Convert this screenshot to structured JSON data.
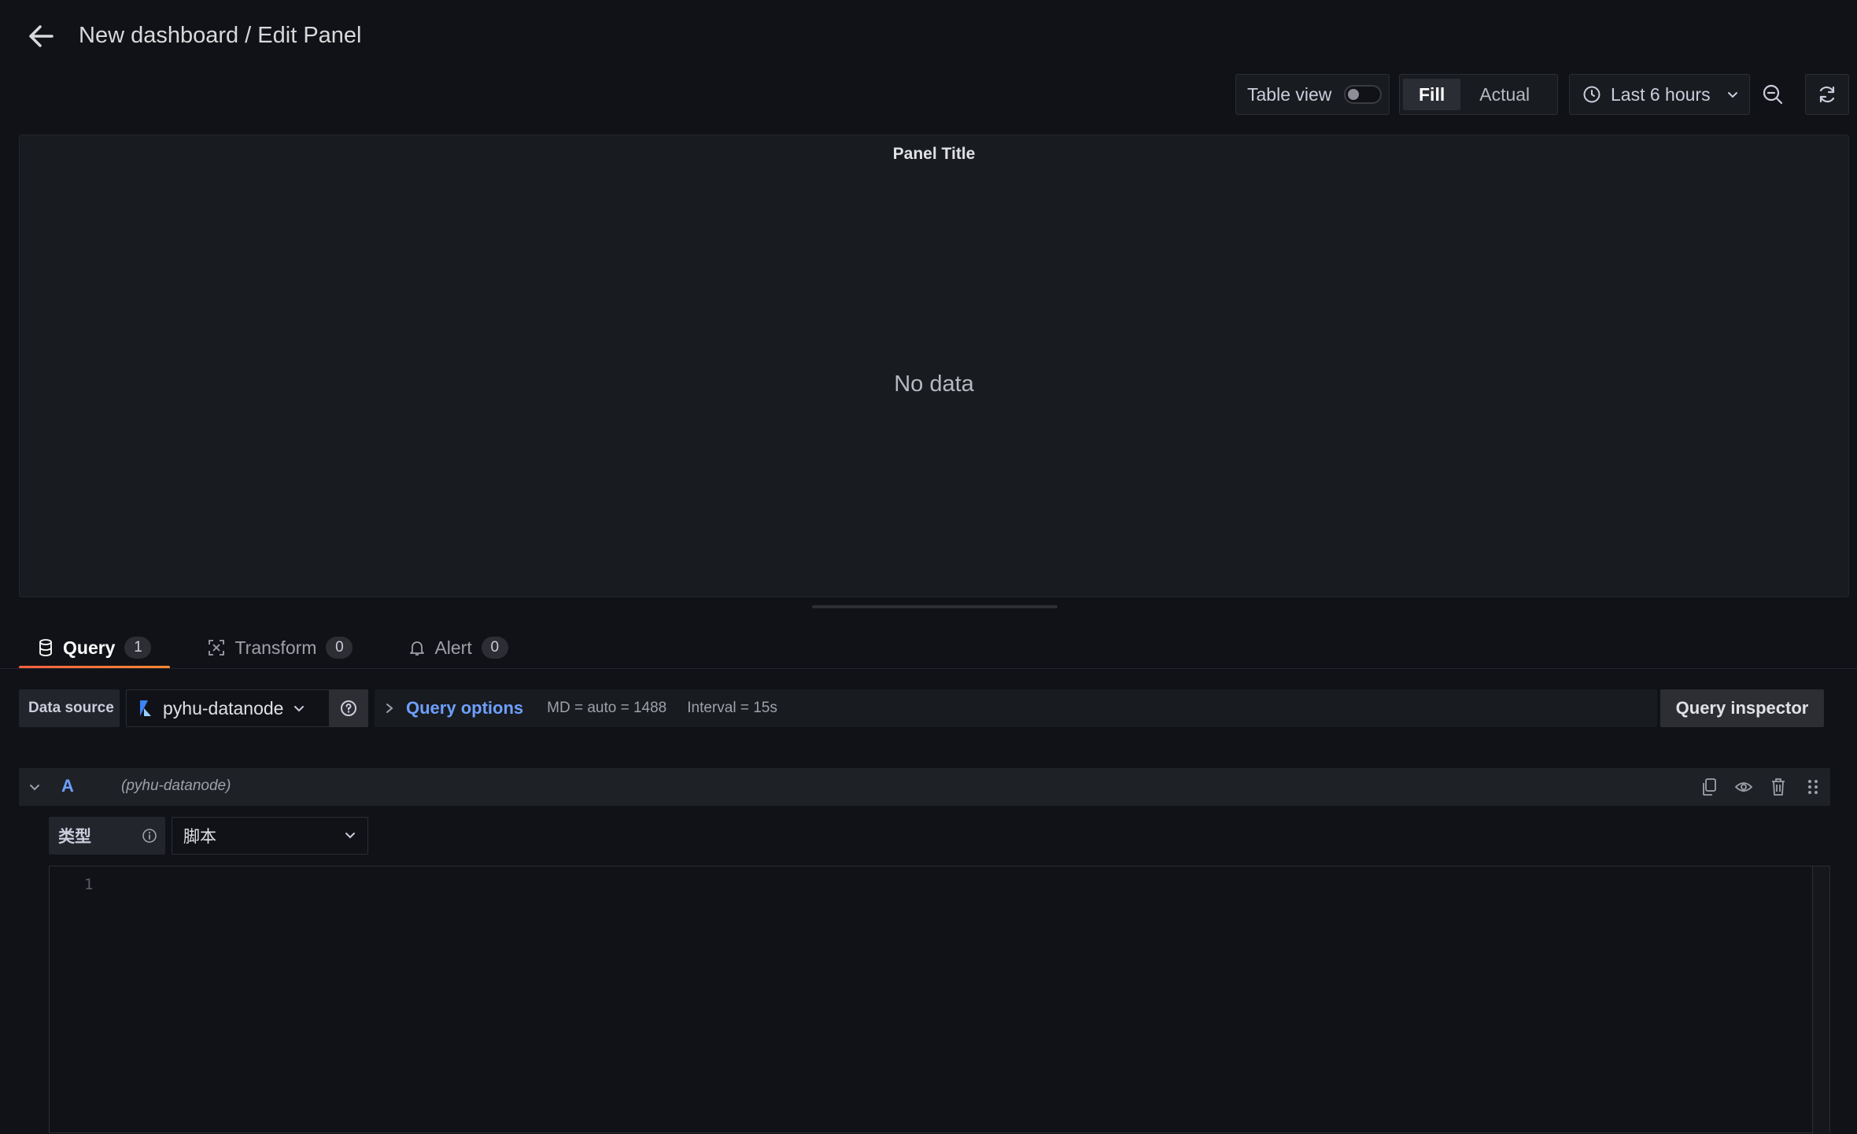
{
  "header": {
    "title": "New dashboard / Edit Panel",
    "back_icon": "arrow-left-icon"
  },
  "toolbar": {
    "table_view_label": "Table view",
    "table_view_on": false,
    "fill_label": "Fill",
    "actual_label": "Actual",
    "time_range_label": "Last 6 hours"
  },
  "panel": {
    "title": "Panel Title",
    "empty_text": "No data"
  },
  "tabs": [
    {
      "label": "Query",
      "count": "1",
      "icon": "database-icon"
    },
    {
      "label": "Transform",
      "count": "0",
      "icon": "transform-icon"
    },
    {
      "label": "Alert",
      "count": "0",
      "icon": "bell-icon"
    }
  ],
  "datasource": {
    "label": "Data source",
    "selected": "pyhu-datanode",
    "query_options_label": "Query options",
    "md_text": "MD = auto = 1488",
    "interval_text": "Interval = 15s",
    "inspector_label": "Query inspector"
  },
  "query": {
    "ref_id": "A",
    "datasource_name": "(pyhu-datanode)",
    "type_label": "类型",
    "type_value": "脚本",
    "editor_line": "1"
  },
  "colors": {
    "accent_blue": "#6e9fff",
    "tab_underline": "#f55f3e",
    "background": "#111217",
    "panel": "#181b1f"
  }
}
